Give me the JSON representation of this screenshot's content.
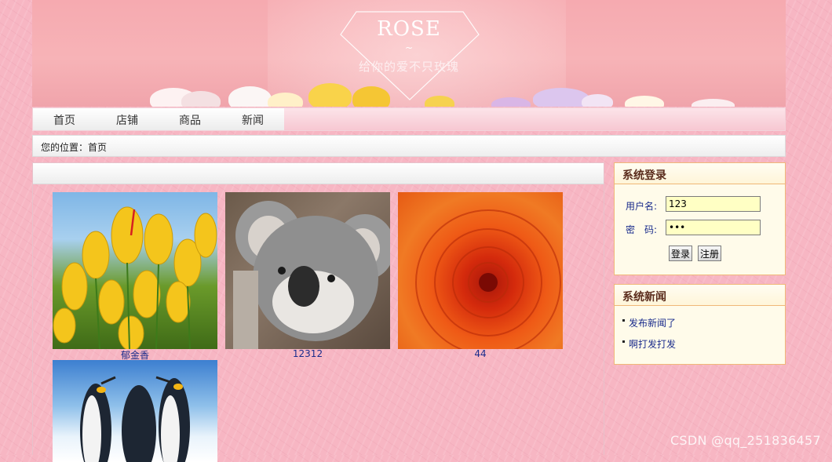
{
  "banner": {
    "title": "ROSE",
    "tilde": "~",
    "subtitle": "给你的爱不只玫瑰"
  },
  "nav": {
    "items": [
      {
        "label": "首页"
      },
      {
        "label": "店铺"
      },
      {
        "label": "商品"
      },
      {
        "label": "新闻"
      }
    ]
  },
  "breadcrumb": {
    "text": "您的位置：首页"
  },
  "products": [
    {
      "name": "郁金香",
      "image": "yellow-tulips"
    },
    {
      "name": "12312",
      "image": "koala"
    },
    {
      "name": "44",
      "image": "orange-chrysanthemum"
    },
    {
      "name": "",
      "image": "penguins"
    }
  ],
  "login": {
    "title": "系统登录",
    "username_label": "用户名:",
    "username_value": "123",
    "password_label": "密　码:",
    "password_value": "123",
    "login_button": "登录",
    "register_button": "注册"
  },
  "news": {
    "title": "系统新闻",
    "items": [
      {
        "label": "发布新闻了"
      },
      {
        "label": "啊打发打发"
      }
    ]
  },
  "watermark": "CSDN @qq_251836457",
  "colors": {
    "background_pink": "#f7b6c3",
    "link_blue": "#1a2c8c",
    "sidebar_border": "#f0b878",
    "sidebar_bg": "#fffbea",
    "input_bg": "#ffffc4"
  }
}
